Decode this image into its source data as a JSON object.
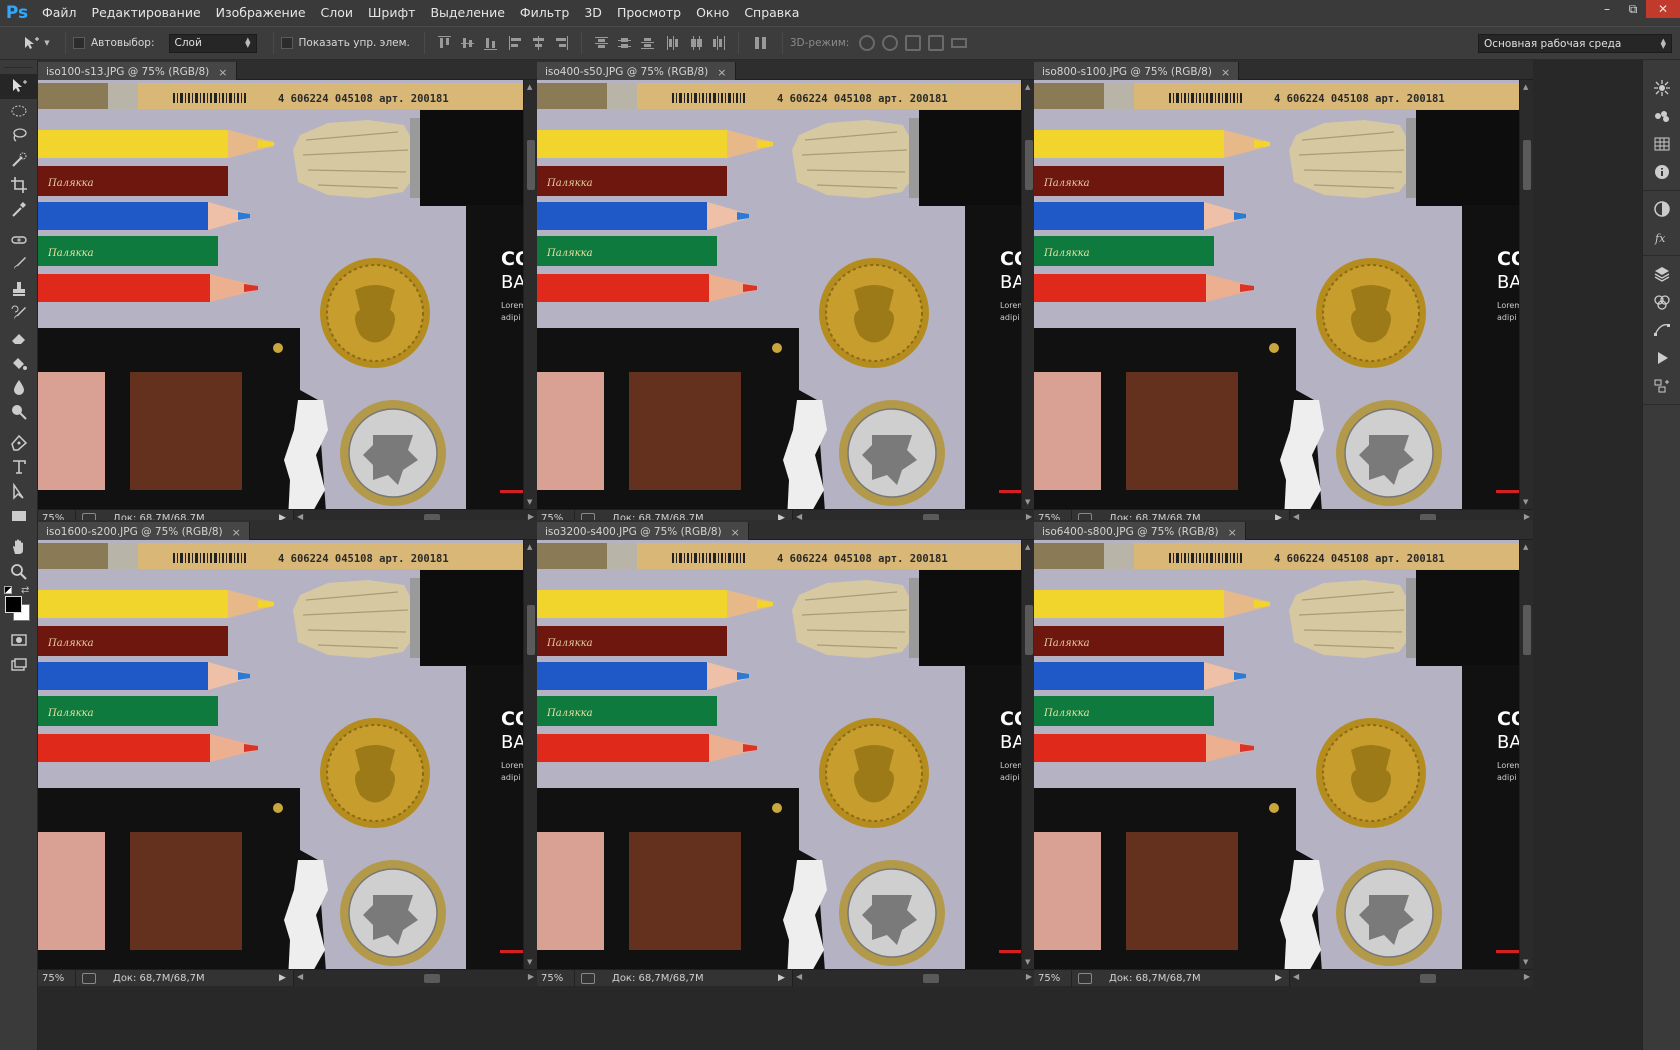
{
  "app": {
    "logo": "Ps"
  },
  "menu": [
    "Файл",
    "Редактирование",
    "Изображение",
    "Слои",
    "Шрифт",
    "Выделение",
    "Фильтр",
    "3D",
    "Просмотр",
    "Окно",
    "Справка"
  ],
  "window_controls": {
    "minimize": "–",
    "restore": "⧉",
    "close": "✕"
  },
  "options_bar": {
    "autoselect_label": "Автовыбор:",
    "autoselect_target": "Слой",
    "show_transform_label": "Показать упр. элем.",
    "mode3d_label": "3D-режим:",
    "workspace": "Основная рабочая среда"
  },
  "documents": [
    {
      "tab": "iso100-s13.JPG @ 75% (RGB/8)",
      "zoom": "75%",
      "doc_size": "Док: 68,7M/68,7M",
      "close": "×"
    },
    {
      "tab": "iso400-s50.JPG @ 75% (RGB/8)",
      "zoom": "75%",
      "doc_size": "Док: 68,7M/68,7M",
      "close": "×"
    },
    {
      "tab": "iso800-s100.JPG @ 75% (RGB/8)",
      "zoom": "75%",
      "doc_size": "Док: 68,7M/68,7M",
      "close": "×"
    },
    {
      "tab": "iso1600-s200.JPG @ 75% (RGB/8)",
      "zoom": "75%",
      "doc_size": "Док: 68,7M/68,7M",
      "close": "×"
    },
    {
      "tab": "iso3200-s400.JPG @ 75% (RGB/8)",
      "zoom": "75%",
      "doc_size": "Док: 68,7M/68,7M",
      "close": "×"
    },
    {
      "tab": "iso6400-s800.JPG @ 75% (RGB/8)",
      "zoom": "75%",
      "doc_size": "Док: 68,7M/68,7M",
      "close": "×"
    }
  ],
  "photo": {
    "pencil_barcode_text": "4 606224 045108 арт. 200181",
    "pencil_brand": "Палякка",
    "book_heading": "CO",
    "book_sub": "BA",
    "book_lorem": "Lorem",
    "book_adipi": "adipi"
  },
  "colors": {
    "foreground": "#000000",
    "background": "#ffffff",
    "accent": "#31a8ff"
  }
}
